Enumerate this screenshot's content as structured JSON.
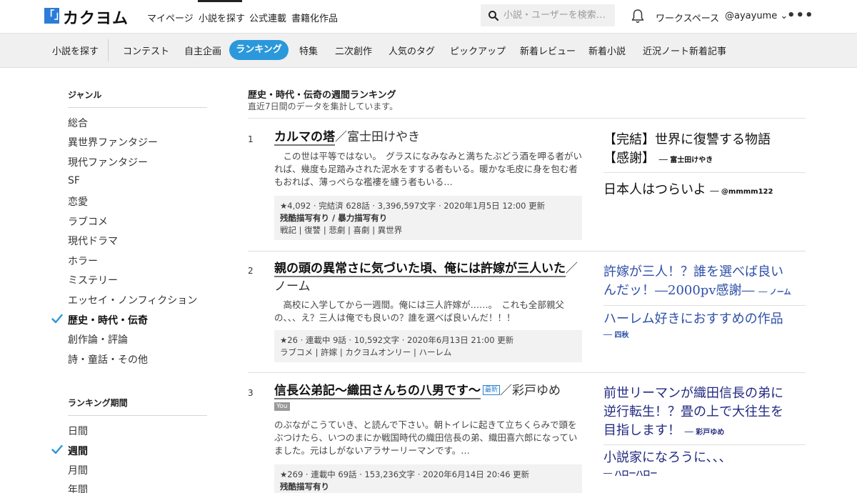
{
  "header": {
    "logo_mark": "「」",
    "logo_text": "カクヨム",
    "nav": [
      "マイページ",
      "小説を探す",
      "公式連載",
      "書籍化作品"
    ],
    "search_placeholder": "小説・ユーザーを検索…",
    "workspace": "ワークスペース",
    "user": "@ayayume ⌄",
    "more": "•••"
  },
  "subnav": {
    "items": [
      "小説を探す",
      "コンテスト",
      "自主企画",
      "ランキング",
      "特集",
      "二次創作",
      "人気のタグ",
      "ピックアップ",
      "新着レビュー",
      "新着小説",
      "近況ノート新着記事"
    ],
    "active": "ランキング"
  },
  "sidebar": {
    "genre_heading": "ジャンル",
    "genres": [
      "総合",
      "異世界ファンタジー",
      "現代ファンタジー",
      "SF",
      "恋愛",
      "ラブコメ",
      "現代ドラマ",
      "ホラー",
      "ミステリー",
      "エッセイ・ノンフィクション",
      "歴史・時代・伝奇",
      "創作論・評論",
      "詩・童話・その他"
    ],
    "active_genre": "歴史・時代・伝奇",
    "period_heading": "ランキング期間",
    "periods": [
      "日間",
      "週間",
      "月間",
      "年間"
    ],
    "active_period": "週間"
  },
  "ranking": {
    "title": "歴史・時代・伝奇の週間ランキング",
    "subtitle": "直近7日間のデータを集計しています。",
    "entries": [
      {
        "rank": "1",
        "title": "カルマの塔",
        "author": "／富士田けやき",
        "catch": "　この世は平等ではない。　グラスになみなみと満ちたぶどう酒を呷る者がいれば、幾度も足踏みされた泥水をすする者もいる。暖かな毛皮に身を包む者もおれば、薄っぺらな襤褸を纏う者もいる…",
        "meta": "★4,092 · 完結済 628話 · 3,396,597文字 · 2020年1月5日 12:00 更新",
        "warnings": "残酷描写有り / 暴力描写有り",
        "tags": "戦記 | 復讐 | 悲劇 | 喜劇 | 異世界",
        "reviews": [
          {
            "title": "【完結】世界に復讐する物語",
            "title2": "【感謝】",
            "by": "── 富士田けやき"
          },
          {
            "title": "日本人はつらいよ",
            "by": "── @mmmm122"
          }
        ]
      },
      {
        "rank": "2",
        "title": "親の頭の異常さに気づいた頃、俺には許嫁が三人いた",
        "author": "／ノーム",
        "catch": "　高校に入学してから一週間。俺には三人許嫁が……。　これも全部親父の、、、え？三人は俺でも良いの？誰を選べば良いんだ！！！",
        "meta": "★26 · 連載中 9話 · 10,592文字 · 2020年6月13日 21:00 更新",
        "tags": "ラブコメ | 許嫁 | カクヨムオンリー | ハーレム",
        "reviews": [
          {
            "title": "許嫁が三人！？誰を選べば良い",
            "title2": "んだッ！―2000pv感謝―",
            "by": "── ノーム"
          },
          {
            "title": "ハーレム好きにおすすめの作品",
            "by": "── 四秋"
          }
        ]
      },
      {
        "rank": "3",
        "title": "信長公弟記～織田さんちの八男です～",
        "badge": "最新",
        "author": "／彩戸ゆめ",
        "you": "You",
        "catch": "のぶながこうていき、と読んで下さい。朝トイレに起きて立ちくらみで頭をぶつけたら、いつのまにか戦国時代の織田信長の弟、織田喜六郎になっていました。元はしがないアラサーリーマンです。…",
        "meta": "★269 · 連載中 69話 · 153,236文字 · 2020年6月14日 20:46 更新",
        "warnings": "残酷描写有り",
        "reviews": [
          {
            "title": "前世リーマンが織田信長の弟に",
            "title2": "逆行転生！？畳の上で大往生を",
            "title3": "目指します！",
            "by": "── 彩戸ゆめ"
          },
          {
            "title": "小説家になろうに、、、",
            "by": "── ハローハロー"
          }
        ]
      }
    ]
  }
}
